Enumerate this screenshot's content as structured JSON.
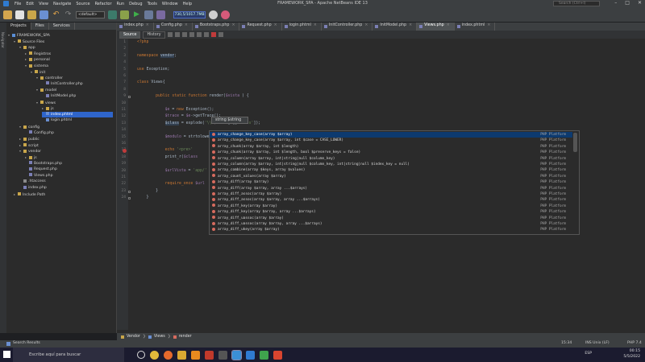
{
  "titlebar": {
    "menu": [
      "File",
      "Edit",
      "View",
      "Navigate",
      "Source",
      "Refactor",
      "Run",
      "Debug",
      "Tools",
      "Window",
      "Help"
    ],
    "title": "FRAMEWORK_SPA - Apache NetBeans IDE 13",
    "search_placeholder": "Search (Ctrl+I)"
  },
  "toolbar": {
    "config_value": "<default>",
    "memory_label": "730,5/1017.7MB"
  },
  "left_strip": {
    "label": "Navigator"
  },
  "project_panel": {
    "tabs": [
      "Projects",
      "Files",
      "Services"
    ],
    "tree": [
      {
        "label": "FRAMEWORK_SPA",
        "indent": 0,
        "icon": "root",
        "toggle": "▾"
      },
      {
        "label": "Source Files",
        "indent": 1,
        "icon": "folder",
        "toggle": "▾"
      },
      {
        "label": "app",
        "indent": 2,
        "icon": "folder",
        "toggle": "▾"
      },
      {
        "label": "Registros",
        "indent": 3,
        "icon": "folder",
        "toggle": "▸"
      },
      {
        "label": "personal",
        "indent": 3,
        "icon": "folder",
        "toggle": "▸"
      },
      {
        "label": "sistema",
        "indent": 3,
        "icon": "folder",
        "toggle": "▾"
      },
      {
        "label": "init",
        "indent": 4,
        "icon": "folder",
        "toggle": "▾"
      },
      {
        "label": "controller",
        "indent": 5,
        "icon": "folder",
        "toggle": "▾"
      },
      {
        "label": "InitController.php",
        "indent": 6,
        "icon": "php",
        "toggle": ""
      },
      {
        "label": "model",
        "indent": 5,
        "icon": "folder",
        "toggle": "▾"
      },
      {
        "label": "InitModel.php",
        "indent": 6,
        "icon": "php",
        "toggle": ""
      },
      {
        "label": "views",
        "indent": 5,
        "icon": "folder",
        "toggle": "▾"
      },
      {
        "label": "js",
        "indent": 6,
        "icon": "folder",
        "toggle": "▸"
      },
      {
        "label": "index.phtml",
        "indent": 6,
        "icon": "phtml",
        "toggle": "",
        "selected": true
      },
      {
        "label": "login.phtml",
        "indent": 6,
        "icon": "phtml",
        "toggle": ""
      },
      {
        "label": "config",
        "indent": 2,
        "icon": "folder",
        "toggle": "▾"
      },
      {
        "label": "Config.php",
        "indent": 3,
        "icon": "php",
        "toggle": ""
      },
      {
        "label": "public",
        "indent": 2,
        "icon": "folder",
        "toggle": "▸"
      },
      {
        "label": "script",
        "indent": 2,
        "icon": "folder",
        "toggle": "▸"
      },
      {
        "label": "vendor",
        "indent": 2,
        "icon": "folder",
        "toggle": "▾"
      },
      {
        "label": "js",
        "indent": 3,
        "icon": "folder",
        "toggle": "▸"
      },
      {
        "label": "Bootstraps.php",
        "indent": 3,
        "icon": "php",
        "toggle": ""
      },
      {
        "label": "Request.php",
        "indent": 3,
        "icon": "php",
        "toggle": ""
      },
      {
        "label": "Views.php",
        "indent": 3,
        "icon": "php",
        "toggle": ""
      },
      {
        "label": ".htaccess",
        "indent": 2,
        "icon": "cfg",
        "toggle": ""
      },
      {
        "label": "index.php",
        "indent": 2,
        "icon": "php",
        "toggle": ""
      },
      {
        "label": "Include Path",
        "indent": 1,
        "icon": "folder",
        "toggle": "▸"
      }
    ]
  },
  "editor": {
    "tabs": [
      {
        "label": "index.php",
        "active": false
      },
      {
        "label": "Config.php",
        "active": false
      },
      {
        "label": "Bootstraps.php",
        "active": false
      },
      {
        "label": "Request.php",
        "active": false
      },
      {
        "label": "login.phtml",
        "active": false
      },
      {
        "label": "InitController.php",
        "active": false
      },
      {
        "label": "InitModel.php",
        "active": false
      },
      {
        "label": "Views.php",
        "active": true
      },
      {
        "label": "index.phtml",
        "active": false
      }
    ],
    "subtabs": [
      "Source",
      "History"
    ],
    "line_numbers": [
      "1",
      "2",
      "3",
      "4",
      "5",
      "6",
      "7",
      "8",
      "9",
      "10",
      "11",
      "12",
      "13",
      "14",
      "15",
      "16",
      "17",
      "18",
      "19",
      "20",
      "21",
      "22",
      "23",
      "24"
    ],
    "code_lines": [
      {
        "n": 1,
        "parts": [
          [
            "kw",
            "<?php"
          ]
        ]
      },
      {
        "n": 3,
        "parts": [
          [
            "kw",
            "namespace "
          ],
          [
            "hl",
            "vendor"
          ],
          [
            "",
            "; "
          ]
        ]
      },
      {
        "n": 5,
        "parts": [
          [
            "kw",
            "use "
          ],
          [
            "",
            "Exception;"
          ]
        ]
      },
      {
        "n": 7,
        "parts": [
          [
            "kw",
            "class "
          ],
          [
            "",
            "Views{"
          ]
        ]
      },
      {
        "n": 9,
        "parts": [
          [
            "",
            "        "
          ],
          [
            "kw",
            "public static function "
          ],
          [
            "",
            "render("
          ],
          [
            "var",
            "$vista"
          ],
          [
            "",
            " ) {"
          ]
        ]
      },
      {
        "n": 11,
        "parts": [
          [
            "",
            "            "
          ],
          [
            "var",
            "$e"
          ],
          [
            "",
            " = "
          ],
          [
            "kw",
            "new "
          ],
          [
            "",
            "Exception();"
          ]
        ]
      },
      {
        "n": 12,
        "parts": [
          [
            "",
            "            "
          ],
          [
            "var",
            "$trace"
          ],
          [
            "",
            " = "
          ],
          [
            "var",
            "$e"
          ],
          [
            "",
            "->getTrace();"
          ]
        ]
      },
      {
        "n": 13,
        "parts": [
          [
            "",
            "            "
          ],
          [
            "hl",
            "$class"
          ],
          [
            "",
            " = explode("
          ],
          [
            "str",
            "'\\\\'"
          ],
          [
            ", "
          ],
          [
            "var",
            "$trace"
          ],
          [
            "",
            "["
          ],
          [
            "str",
            "1"
          ],
          [
            "",
            "]["
          ],
          [
            "str",
            "'class'"
          ],
          [
            "",
            "]);"
          ]
        ]
      },
      {
        "n": 15,
        "parts": [
          [
            "",
            "            "
          ],
          [
            "var",
            "$modulo"
          ],
          [
            "",
            " = strtolower("
          ],
          [
            "hl",
            "array"
          ]
        ]
      },
      {
        "n": 17,
        "parts": [
          [
            "",
            "            "
          ],
          [
            "kw",
            "echo "
          ],
          [
            "str",
            "'<pre>'"
          ],
          [
            ";"
          ]
        ]
      },
      {
        "n": 18,
        "parts": [
          [
            "",
            "            print_r("
          ],
          [
            "var",
            "$class"
          ],
          [
            ");"
          ]
        ]
      },
      {
        "n": 20,
        "parts": [
          [
            "",
            "            "
          ],
          [
            "var",
            "$urlVista"
          ],
          [
            "",
            " = "
          ],
          [
            "str",
            "'app/'"
          ]
        ]
      },
      {
        "n": 22,
        "parts": [
          [
            "",
            "            "
          ],
          [
            "kw",
            "require_once "
          ],
          [
            "var",
            "$url"
          ]
        ]
      },
      {
        "n": 23,
        "parts": [
          [
            "",
            "        }"
          ]
        ]
      },
      {
        "n": 24,
        "parts": [
          [
            "",
            "    }"
          ]
        ]
      }
    ],
    "tooltip": "string $string"
  },
  "completion": {
    "items": [
      {
        "sig": "array_change_key_case(array $array)",
        "platform": "PHP Platform",
        "selected": true
      },
      {
        "sig": "array_change_key_case(array $array, int $case = CASE_LOWER)",
        "platform": "PHP Platform"
      },
      {
        "sig": "array_chunk(array $array, int $length)",
        "platform": "PHP Platform"
      },
      {
        "sig": "array_chunk(array $array, int $length, bool $preserve_keys = false)",
        "platform": "PHP Platform"
      },
      {
        "sig": "array_column(array $array, int|string|null $column_key)",
        "platform": "PHP Platform"
      },
      {
        "sig": "array_column(array $array, int|string|null $column_key, int|string|null $index_key = null)",
        "platform": "PHP Platform"
      },
      {
        "sig": "array_combine(array $keys, array $values)",
        "platform": "PHP Platform"
      },
      {
        "sig": "array_count_values(array $array)",
        "platform": "PHP Platform"
      },
      {
        "sig": "array_diff(array $array)",
        "platform": "PHP Platform"
      },
      {
        "sig": "array_diff(array $array, array ...$arrays)",
        "platform": "PHP Platform"
      },
      {
        "sig": "array_diff_assoc(array $array)",
        "platform": "PHP Platform"
      },
      {
        "sig": "array_diff_assoc(array $array, array ...$arrays)",
        "platform": "PHP Platform"
      },
      {
        "sig": "array_diff_key(array $array)",
        "platform": "PHP Platform"
      },
      {
        "sig": "array_diff_key(array $array, array ...$arrays)",
        "platform": "PHP Platform"
      },
      {
        "sig": "array_diff_uassoc(array $array)",
        "platform": "PHP Platform"
      },
      {
        "sig": "array_diff_uassoc(array $array, array ...$arrays)",
        "platform": "PHP Platform"
      },
      {
        "sig": "array_diff_ukey(array $array)",
        "platform": "PHP Platform"
      }
    ]
  },
  "breadcrumb": [
    "Vendor",
    "Views",
    "render"
  ],
  "statusbar": {
    "search_results": "Search Results",
    "position": "15:34",
    "mode": "INS Unix (LF)",
    "php": "PHP 7.4"
  },
  "taskbar": {
    "search_placeholder": "Escribe aquí para buscar",
    "lang": "ESP",
    "time": "00:15",
    "date": "5/5/2022"
  }
}
